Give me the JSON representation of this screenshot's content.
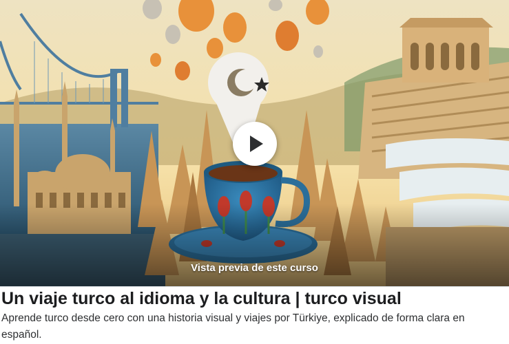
{
  "course": {
    "preview_label": "Vista previa de este curso",
    "title": "Un viaje turco al idioma y la cultura | turco visual",
    "subtitle": "Aprende turco desde cero con una historia visual y viajes por Türkiye, explicado de forma clara en español."
  },
  "icons": {
    "play": "play-icon",
    "flag": "crescent-star-icon"
  },
  "colors": {
    "sky": "#f3e3b8",
    "balloon": "#e8913a",
    "water": "#3d6f8e",
    "play_button": "#ffffff"
  }
}
